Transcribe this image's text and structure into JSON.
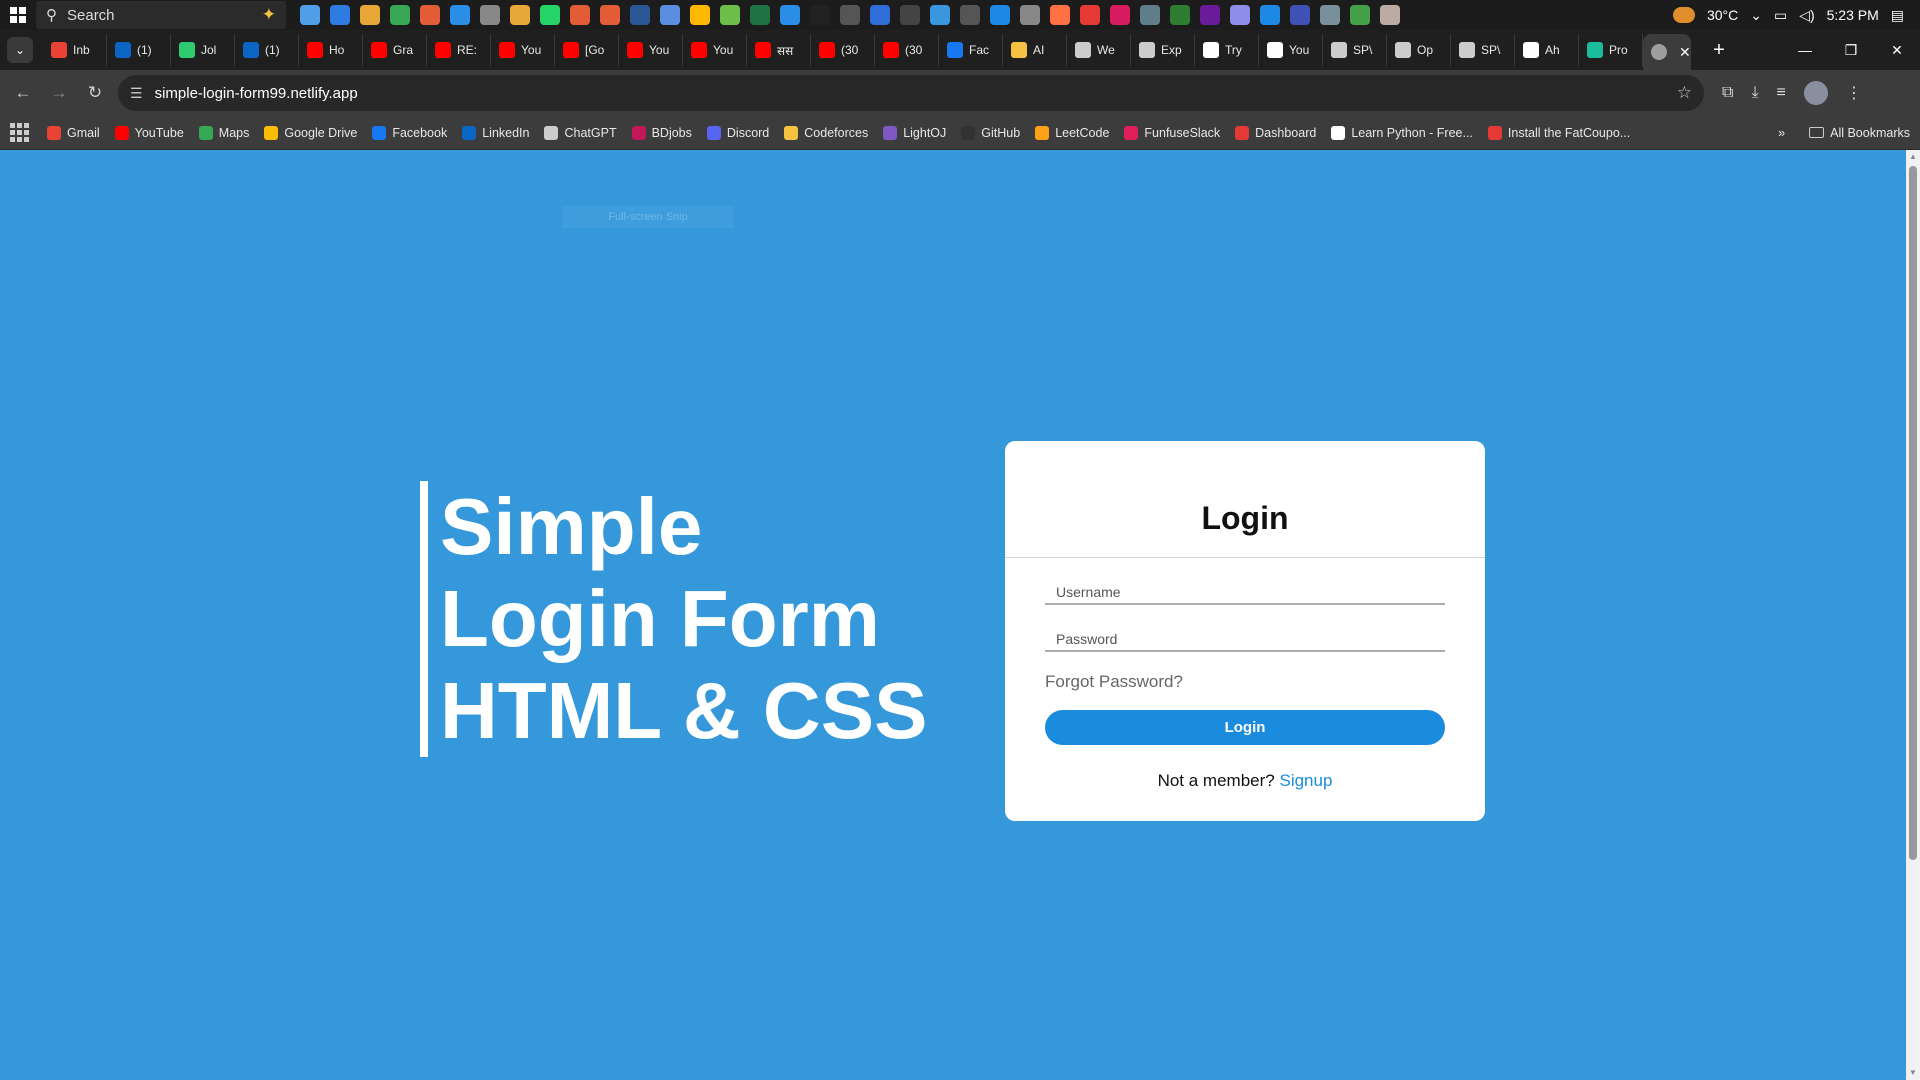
{
  "taskbar": {
    "search_label": "Search",
    "temperature": "30°C",
    "time": "5:23 PM",
    "pinned_colors": [
      "#4f9fe8",
      "#2d7be0",
      "#e8a838",
      "#3aa757",
      "#e25c37",
      "#2b8ee6",
      "#888888",
      "#e8a838",
      "#25d366",
      "#e25c37",
      "#e25c37",
      "#2b5797",
      "#5c8ee0",
      "#ffb900",
      "#6cc04a",
      "#1f7244",
      "#2b8ee6",
      "#222222",
      "#555555",
      "#2f6ed8",
      "#444444",
      "#3a96dd",
      "#555555",
      "#1e88e5",
      "#888888",
      "#ff7043",
      "#e53935",
      "#d81b60",
      "#607d8b",
      "#2e7d32",
      "#6a1b9a",
      "#8e8ee8",
      "#1e88e5",
      "#3f51b5",
      "#78909c",
      "#43a047",
      "#bcaaa4"
    ]
  },
  "tabstrip": {
    "tabs": [
      {
        "label": "Inb",
        "color": "#ea4335"
      },
      {
        "label": "(1)",
        "color": "#0a66c2"
      },
      {
        "label": "Jol",
        "color": "#2ecc71"
      },
      {
        "label": "(1)",
        "color": "#0a66c2"
      },
      {
        "label": "Ho",
        "color": "#ff0000"
      },
      {
        "label": "Gra",
        "color": "#ff0000"
      },
      {
        "label": "RE:",
        "color": "#ff0000"
      },
      {
        "label": "You",
        "color": "#ff0000"
      },
      {
        "label": "[Go",
        "color": "#ff0000"
      },
      {
        "label": "You",
        "color": "#ff0000"
      },
      {
        "label": "You",
        "color": "#ff0000"
      },
      {
        "label": "सस",
        "color": "#ff0000"
      },
      {
        "label": "(30",
        "color": "#ff0000"
      },
      {
        "label": "(30",
        "color": "#ff0000"
      },
      {
        "label": "Fac",
        "color": "#1877f2"
      },
      {
        "label": "AI",
        "color": "#f5c242"
      },
      {
        "label": "We",
        "color": "#cccccc"
      },
      {
        "label": "Exp",
        "color": "#cccccc"
      },
      {
        "label": "Try",
        "color": "#ffffff"
      },
      {
        "label": "You",
        "color": "#ffffff"
      },
      {
        "label": "SP\\",
        "color": "#cccccc"
      },
      {
        "label": "Op",
        "color": "#cccccc"
      },
      {
        "label": "SP\\",
        "color": "#cccccc"
      },
      {
        "label": "Ah",
        "color": "#ffffff"
      },
      {
        "label": "Pro",
        "color": "#1abc9c"
      }
    ],
    "active_color": "#9e9e9e"
  },
  "toolbar": {
    "url": "simple-login-form99.netlify.app"
  },
  "bookmarks": {
    "items": [
      {
        "label": "Gmail",
        "color": "#ea4335"
      },
      {
        "label": "YouTube",
        "color": "#ff0000"
      },
      {
        "label": "Maps",
        "color": "#34a853"
      },
      {
        "label": "Google Drive",
        "color": "#fbbc04"
      },
      {
        "label": "Facebook",
        "color": "#1877f2"
      },
      {
        "label": "LinkedIn",
        "color": "#0a66c2"
      },
      {
        "label": "ChatGPT",
        "color": "#cccccc"
      },
      {
        "label": "BDjobs",
        "color": "#c2185b"
      },
      {
        "label": "Discord",
        "color": "#5865f2"
      },
      {
        "label": "Codeforces",
        "color": "#f5c242"
      },
      {
        "label": "LightOJ",
        "color": "#7e57c2"
      },
      {
        "label": "GitHub",
        "color": "#333333"
      },
      {
        "label": "LeetCode",
        "color": "#ffa116"
      },
      {
        "label": "FunfuseSlack",
        "color": "#e01e5a"
      },
      {
        "label": "Dashboard",
        "color": "#e53935"
      },
      {
        "label": "Learn Python - Free...",
        "color": "#ffffff"
      },
      {
        "label": "Install the FatCoupo...",
        "color": "#e53935"
      }
    ],
    "all_bookmarks_label": "All Bookmarks"
  },
  "page": {
    "snip_hint": "Full-screen Snip",
    "hero_lines": [
      "Simple",
      "Login Form",
      "HTML & CSS"
    ],
    "login": {
      "title": "Login",
      "username_label": "Username",
      "password_label": "Password",
      "forgot_label": "Forgot Password?",
      "button_label": "Login",
      "signup_prompt": "Not a member?",
      "signup_link": "Signup"
    },
    "accent_color": "#3498db",
    "button_color": "#1a8bdd"
  }
}
